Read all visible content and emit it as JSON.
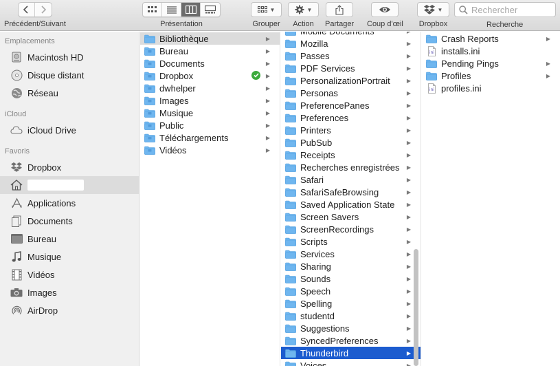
{
  "toolbar": {
    "nav_label": "Précédent/Suivant",
    "view_label": "Présentation",
    "group_label": "Grouper",
    "action_label": "Action",
    "share_label": "Partager",
    "quicklook_label": "Coup d'œil",
    "dropbox_label": "Dropbox",
    "search_label": "Recherche",
    "search_placeholder": "Rechercher",
    "views": [
      "icon-view-icon",
      "list-view-icon",
      "column-view-icon",
      "gallery-view-icon"
    ],
    "active_view": "column-view-icon"
  },
  "sidebar": {
    "sections": [
      {
        "title": "Emplacements",
        "items": [
          {
            "label": "Macintosh HD",
            "icon": "harddisk-icon"
          },
          {
            "label": "Disque distant",
            "icon": "disc-icon"
          },
          {
            "label": "Réseau",
            "icon": "network-icon"
          }
        ]
      },
      {
        "title": "iCloud",
        "items": [
          {
            "label": "iCloud Drive",
            "icon": "cloud-icon"
          }
        ]
      },
      {
        "title": "Favoris",
        "items": [
          {
            "label": "Dropbox",
            "icon": "dropbox-icon"
          },
          {
            "label": "",
            "icon": "home-icon",
            "selected": true
          },
          {
            "label": "Applications",
            "icon": "applications-icon"
          },
          {
            "label": "Documents",
            "icon": "documents-icon"
          },
          {
            "label": "Bureau",
            "icon": "desktop-icon"
          },
          {
            "label": "Musique",
            "icon": "music-icon"
          },
          {
            "label": "Vidéos",
            "icon": "video-icon"
          },
          {
            "label": "Images",
            "icon": "camera-icon"
          },
          {
            "label": "AirDrop",
            "icon": "airdrop-icon"
          }
        ]
      }
    ]
  },
  "columns": {
    "col1": [
      {
        "label": "Bibliothèque",
        "selected": "grey"
      },
      {
        "label": "Bureau"
      },
      {
        "label": "Documents"
      },
      {
        "label": "Dropbox",
        "synced": true
      },
      {
        "label": "dwhelper"
      },
      {
        "label": "Images"
      },
      {
        "label": "Musique"
      },
      {
        "label": "Public"
      },
      {
        "label": "Téléchargements"
      },
      {
        "label": "Vidéos"
      }
    ],
    "col2_top_partial": "Mobile Documents",
    "col2": [
      "Mozilla",
      "Passes",
      "PDF Services",
      "PersonalizationPortrait",
      "Personas",
      "PreferencePanes",
      "Preferences",
      "Printers",
      "PubSub",
      "Receipts",
      "Recherches enregistrées",
      "Safari",
      "SafariSafeBrowsing",
      "Saved Application State",
      "Screen Savers",
      "ScreenRecordings",
      "Scripts",
      "Services",
      "Sharing",
      "Sounds",
      "Speech",
      "Spelling",
      "studentd",
      "Suggestions",
      "SyncedPreferences",
      "Thunderbird",
      "Voices"
    ],
    "col2_selected": "Thunderbird",
    "col3": [
      {
        "label": "Crash Reports",
        "type": "folder"
      },
      {
        "label": "installs.ini",
        "type": "file"
      },
      {
        "label": "Pending Pings",
        "type": "folder"
      },
      {
        "label": "Profiles",
        "type": "folder"
      },
      {
        "label": "profiles.ini",
        "type": "file"
      }
    ]
  },
  "colors": {
    "selection_blue": "#1c5ccf",
    "folder_blue": "#6fb6ef",
    "synced_green": "#3caa3c"
  }
}
